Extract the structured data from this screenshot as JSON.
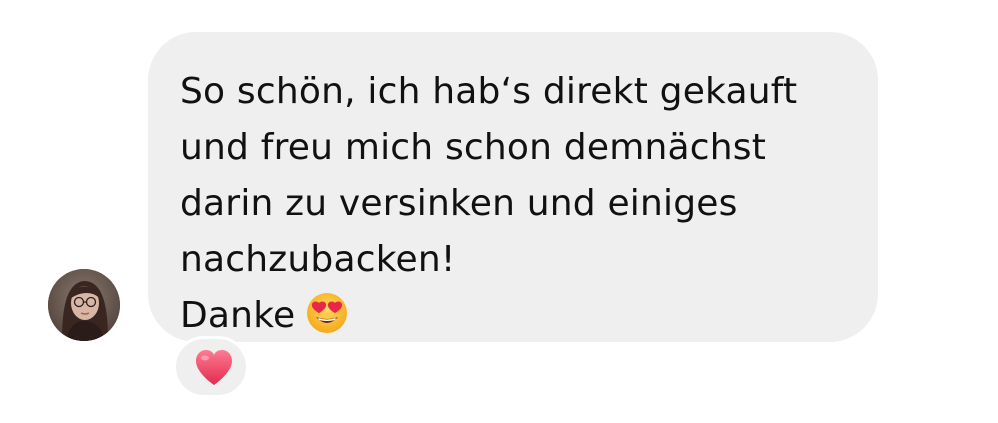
{
  "message": {
    "lines": [
      "So schön, ich hab‘s direkt gekauft",
      "und freu mich schon demnächst",
      "darin zu versinken und einiges",
      "nachzubacken!",
      "Danke"
    ],
    "emoji": "smiling-face-with-heart-eyes",
    "bubble_color": "#efefef",
    "text_color": "#111111"
  },
  "reaction": {
    "emoji": "heart",
    "color": "#e8405e"
  },
  "avatar": {
    "alt": "profile-photo"
  }
}
